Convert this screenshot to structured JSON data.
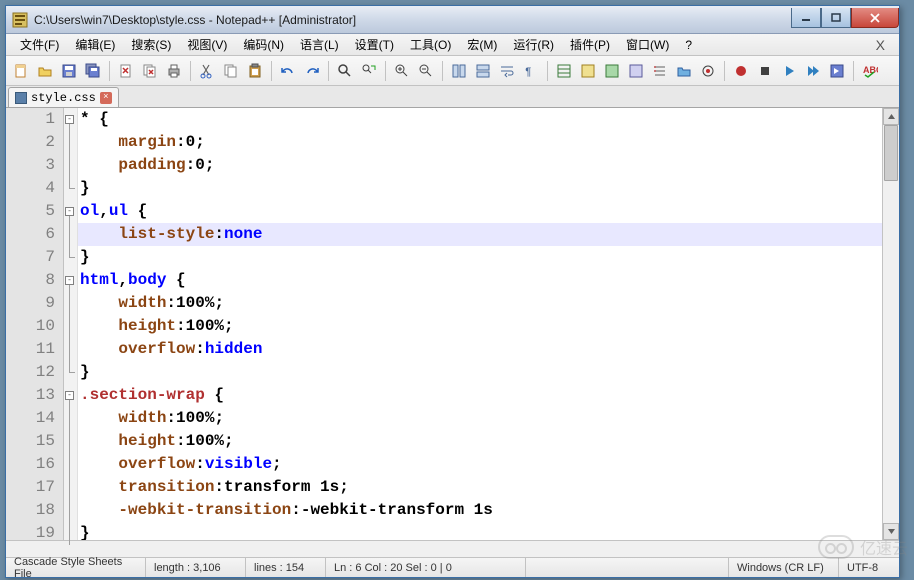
{
  "window": {
    "title": "C:\\Users\\win7\\Desktop\\style.css - Notepad++ [Administrator]"
  },
  "menus": [
    {
      "label": "文件(F)"
    },
    {
      "label": "编辑(E)"
    },
    {
      "label": "搜索(S)"
    },
    {
      "label": "视图(V)"
    },
    {
      "label": "编码(N)"
    },
    {
      "label": "语言(L)"
    },
    {
      "label": "设置(T)"
    },
    {
      "label": "工具(O)"
    },
    {
      "label": "宏(M)"
    },
    {
      "label": "运行(R)"
    },
    {
      "label": "插件(P)"
    },
    {
      "label": "窗口(W)"
    },
    {
      "label": "?"
    }
  ],
  "tab": {
    "name": "style.css"
  },
  "code": {
    "lines": [
      {
        "num": 1,
        "fold": "open",
        "spans": [
          [
            "c-sel",
            "* "
          ],
          [
            "c-punct",
            "{"
          ]
        ]
      },
      {
        "num": 2,
        "spans": [
          [
            "",
            "    "
          ],
          [
            "c-prop",
            "margin"
          ],
          [
            "c-punct",
            ":"
          ],
          [
            "c-val",
            "0"
          ],
          [
            "c-punct",
            ";"
          ]
        ]
      },
      {
        "num": 3,
        "spans": [
          [
            "",
            "    "
          ],
          [
            "c-prop",
            "padding"
          ],
          [
            "c-punct",
            ":"
          ],
          [
            "c-val",
            "0"
          ],
          [
            "c-punct",
            ";"
          ]
        ]
      },
      {
        "num": 4,
        "close": true,
        "spans": [
          [
            "c-punct",
            "}"
          ]
        ]
      },
      {
        "num": 5,
        "fold": "open",
        "spans": [
          [
            "c-kw",
            "ol"
          ],
          [
            "c-punct",
            ","
          ],
          [
            "c-kw",
            "ul"
          ],
          [
            "",
            ""
          ],
          [
            "c-punct",
            " {"
          ]
        ]
      },
      {
        "num": 6,
        "fold": "line",
        "hl": true,
        "spans": [
          [
            "",
            "    "
          ],
          [
            "c-prop",
            "list-style"
          ],
          [
            "c-punct",
            ":"
          ],
          [
            "c-kw",
            "none"
          ]
        ]
      },
      {
        "num": 7,
        "close": true,
        "spans": [
          [
            "c-punct",
            "}"
          ]
        ]
      },
      {
        "num": 8,
        "fold": "open",
        "spans": [
          [
            "c-kw",
            "html"
          ],
          [
            "c-punct",
            ","
          ],
          [
            "c-kw",
            "body"
          ],
          [
            "c-punct",
            " {"
          ]
        ]
      },
      {
        "num": 9,
        "spans": [
          [
            "",
            "    "
          ],
          [
            "c-prop",
            "width"
          ],
          [
            "c-punct",
            ":"
          ],
          [
            "c-val",
            "100%"
          ],
          [
            "c-punct",
            ";"
          ]
        ]
      },
      {
        "num": 10,
        "spans": [
          [
            "",
            "    "
          ],
          [
            "c-prop",
            "height"
          ],
          [
            "c-punct",
            ":"
          ],
          [
            "c-val",
            "100%"
          ],
          [
            "c-punct",
            ";"
          ]
        ]
      },
      {
        "num": 11,
        "spans": [
          [
            "",
            "    "
          ],
          [
            "c-prop",
            "overflow"
          ],
          [
            "c-punct",
            ":"
          ],
          [
            "c-kw",
            "hidden"
          ]
        ]
      },
      {
        "num": 12,
        "close": true,
        "spans": [
          [
            "c-punct",
            "}"
          ]
        ]
      },
      {
        "num": 13,
        "fold": "open",
        "spans": [
          [
            "c-cls",
            ".section-wrap"
          ],
          [
            "c-punct",
            " {"
          ]
        ]
      },
      {
        "num": 14,
        "spans": [
          [
            "",
            "    "
          ],
          [
            "c-prop",
            "width"
          ],
          [
            "c-punct",
            ":"
          ],
          [
            "c-val",
            "100%"
          ],
          [
            "c-punct",
            ";"
          ]
        ]
      },
      {
        "num": 15,
        "spans": [
          [
            "",
            "    "
          ],
          [
            "c-prop",
            "height"
          ],
          [
            "c-punct",
            ":"
          ],
          [
            "c-val",
            "100%"
          ],
          [
            "c-punct",
            ";"
          ]
        ]
      },
      {
        "num": 16,
        "spans": [
          [
            "",
            "    "
          ],
          [
            "c-prop",
            "overflow"
          ],
          [
            "c-punct",
            ":"
          ],
          [
            "c-kw",
            "visible"
          ],
          [
            "c-punct",
            ";"
          ]
        ]
      },
      {
        "num": 17,
        "spans": [
          [
            "",
            "    "
          ],
          [
            "c-prop",
            "transition"
          ],
          [
            "c-punct",
            ":"
          ],
          [
            "c-val",
            "transform 1s"
          ],
          [
            "c-punct",
            ";"
          ]
        ]
      },
      {
        "num": 18,
        "spans": [
          [
            "",
            "    "
          ],
          [
            "c-prop",
            "-webkit-transition"
          ],
          [
            "c-punct",
            ":"
          ],
          [
            "c-val",
            "-webkit-transform 1s"
          ]
        ]
      },
      {
        "num": 19,
        "spans": [
          [
            "c-punct",
            "}"
          ]
        ]
      }
    ]
  },
  "status": {
    "filetype": "Cascade Style Sheets File",
    "length": "length : 3,106",
    "lines": "lines : 154",
    "pos": "Ln : 6    Col : 20    Sel : 0 | 0",
    "eol": "Windows (CR LF)",
    "enc": "UTF-8"
  },
  "watermark": "亿速云"
}
